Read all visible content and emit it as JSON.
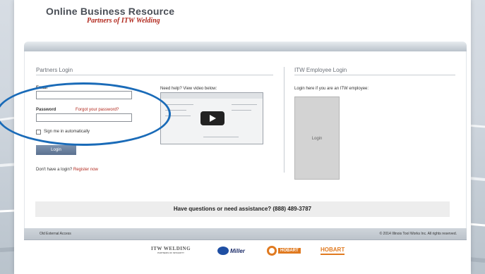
{
  "header": {
    "brand_title": "Online Business Resource",
    "brand_subtitle": "Partners of ITW Welding"
  },
  "partners_login": {
    "section_title": "Partners Login",
    "email_label": "Email",
    "email_value": "",
    "password_label": "Password",
    "password_value": "",
    "forgot_password_link": "Forgot your password?",
    "remember_me_label": "Sign me in automatically",
    "login_button": "Login",
    "no_login_text": "Don't have a login?",
    "register_link": "Register now"
  },
  "video_help": {
    "caption": "Need help? View video below:"
  },
  "itw_employee_login": {
    "section_title": "ITW Employee Login",
    "description": "Login here if you are an ITW employee:",
    "login_box_label": "Login"
  },
  "help_bar": {
    "text": "Have questions or need assistance? (888) 489-3787"
  },
  "footer": {
    "external_access_link": "Old External Access",
    "copyright": "© 2014 Illinois Tool Works Inc. All rights reserved."
  },
  "brand_logos": [
    {
      "name": "ITW WELDING",
      "sub": "PARTNERS OF INTEGRITY"
    },
    {
      "name": "Miller"
    },
    {
      "name": "HOBART"
    },
    {
      "name": "HOBART"
    }
  ],
  "colors": {
    "accent_red": "#b22a1f",
    "button_blue": "#5b7190",
    "annotation_circle": "#1a6bb8",
    "miller_blue": "#1f4fa3",
    "hobart_orange": "#e07a20"
  }
}
